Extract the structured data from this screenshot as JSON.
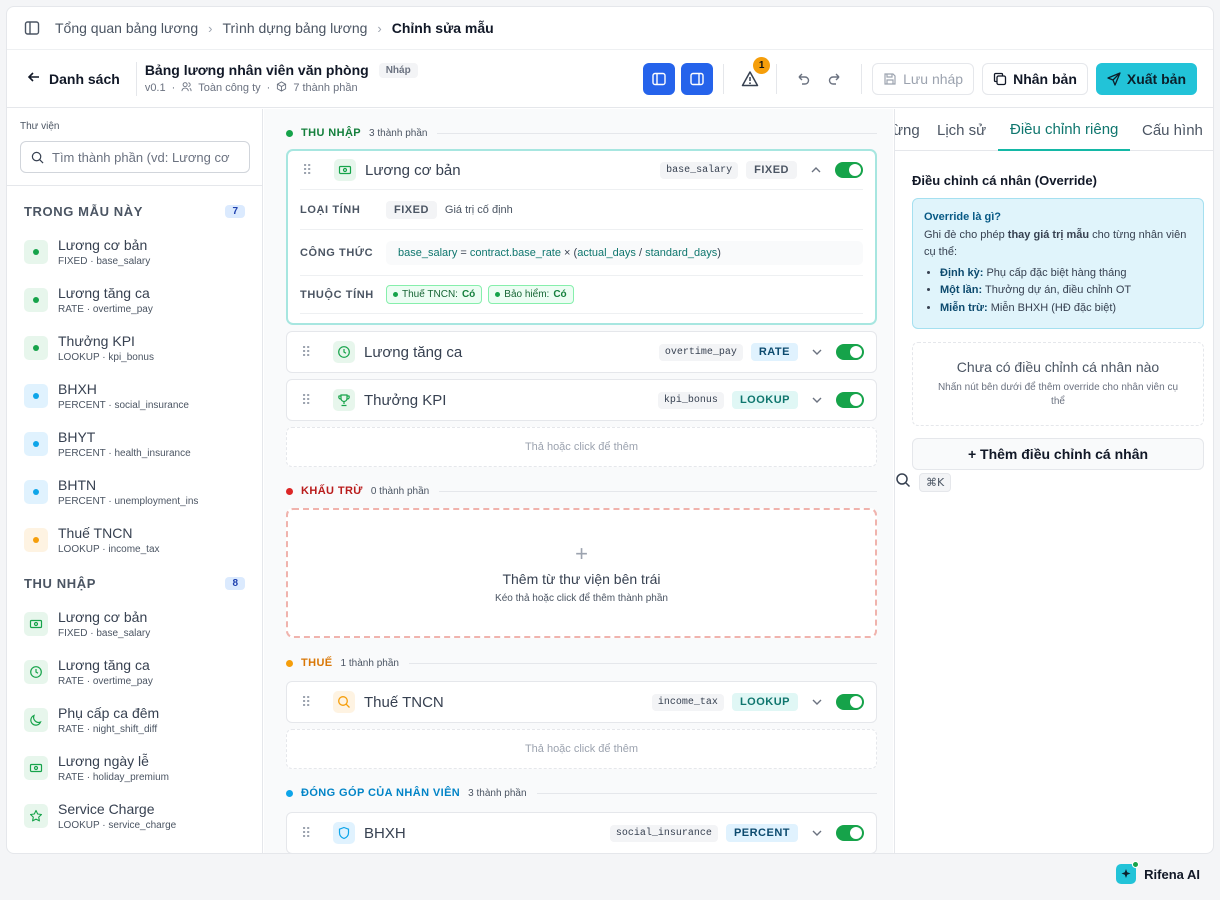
{
  "breadcrumb": {
    "items": [
      "Tổng quan bảng lương",
      "Trình dựng bảng lương",
      "Chỉnh sửa mẫu"
    ],
    "shortcut": "⌘K"
  },
  "header": {
    "back_label": "Danh sách",
    "title": "Bảng lương nhân viên văn phòng",
    "status": "Nháp",
    "version": "v0.1",
    "scope": "Toàn công ty",
    "components": "7 thành phần",
    "warning_count": "1",
    "save_draft": "Lưu nháp",
    "duplicate": "Nhân bản",
    "publish": "Xuất bản"
  },
  "sidebar": {
    "library_label": "Thư viện",
    "search_placeholder": "Tìm thành phần (vd: Lương cơ",
    "in_template": {
      "label": "TRONG MẪU NÀY",
      "count": "7",
      "items": [
        {
          "name": "Lương cơ bản",
          "sub": "FIXED · base_salary",
          "color": "green"
        },
        {
          "name": "Lương tăng ca",
          "sub": "RATE · overtime_pay",
          "color": "green"
        },
        {
          "name": "Thưởng KPI",
          "sub": "LOOKUP · kpi_bonus",
          "color": "green"
        },
        {
          "name": "BHXH",
          "sub": "PERCENT · social_insurance",
          "color": "blue"
        },
        {
          "name": "BHYT",
          "sub": "PERCENT · health_insurance",
          "color": "blue"
        },
        {
          "name": "BHTN",
          "sub": "PERCENT · unemployment_ins",
          "color": "blue"
        },
        {
          "name": "Thuế TNCN",
          "sub": "LOOKUP · income_tax",
          "color": "orange"
        }
      ]
    },
    "income": {
      "label": "THU NHẬP",
      "count": "8",
      "items": [
        {
          "name": "Lương cơ bản",
          "sub": "FIXED · base_salary",
          "icon": "money-icon"
        },
        {
          "name": "Lương tăng ca",
          "sub": "RATE · overtime_pay",
          "icon": "clock-icon"
        },
        {
          "name": "Phụ cấp ca đêm",
          "sub": "RATE · night_shift_diff",
          "icon": "moon-icon"
        },
        {
          "name": "Lương ngày lễ",
          "sub": "RATE · holiday_premium",
          "icon": "money-icon"
        },
        {
          "name": "Service Charge",
          "sub": "LOOKUP · service_charge",
          "icon": "star-icon"
        }
      ]
    }
  },
  "center": {
    "income_group": {
      "label": "THU NHẬP",
      "count": "3 thành phần"
    },
    "base_salary": {
      "name": "Lương cơ bản",
      "key": "base_salary",
      "type": "FIXED",
      "calc_label": "LOẠI TÍNH",
      "calc_value": "FIXED",
      "calc_desc": "Giá trị cố định",
      "formula_label": "CÔNG THỨC",
      "formula": {
        "a": "base_salary",
        "eq": " = ",
        "b": "contract.base_rate",
        "op": " × (",
        "c": "actual_days",
        "div": " / ",
        "d": "standard_days",
        "end": ")"
      },
      "attr_label": "THUỘC TÍNH",
      "attrs": [
        {
          "k": "Thuế TNCN:",
          "v": "Có"
        },
        {
          "k": "Bảo hiểm:",
          "v": "Có"
        }
      ]
    },
    "overtime": {
      "name": "Lương tăng ca",
      "key": "overtime_pay",
      "type": "RATE"
    },
    "kpi": {
      "name": "Thưởng KPI",
      "key": "kpi_bonus",
      "type": "LOOKUP"
    },
    "drop_hint": "Thả hoặc click để thêm",
    "deduction_group": {
      "label": "KHẤU TRỪ",
      "count": "0 thành phần"
    },
    "deduction_empty": {
      "title": "Thêm từ thư viện bên trái",
      "sub": "Kéo thả hoặc click để thêm thành phần"
    },
    "tax_group": {
      "label": "THUẾ",
      "count": "1 thành phần"
    },
    "tax": {
      "name": "Thuế TNCN",
      "key": "income_tax",
      "type": "LOOKUP"
    },
    "contrib_group": {
      "label": "ĐÓNG GÓP CỦA NHÂN VIÊN",
      "count": "3 thành phần"
    },
    "bhxh": {
      "name": "BHXH",
      "key": "social_insurance",
      "type": "PERCENT"
    }
  },
  "right": {
    "tabs": [
      "ừng",
      "Lịch sử",
      "Điều chỉnh riêng",
      "Cấu hình"
    ],
    "active_tab": "Điều chỉnh riêng",
    "title": "Điều chỉnh cá nhân (Override)",
    "info": {
      "heading": "Override là gì?",
      "text_a": "Ghi đè cho phép ",
      "text_b": "thay giá trị mẫu",
      "text_c": " cho từng nhân viên cụ thể:",
      "items": [
        {
          "k": "Định kỳ:",
          "v": " Phụ cấp đặc biệt hàng tháng"
        },
        {
          "k": "Một lần:",
          "v": " Thưởng dự án, điều chỉnh OT"
        },
        {
          "k": "Miễn trừ:",
          "v": " Miễn BHXH (HĐ đặc biệt)"
        }
      ]
    },
    "empty_title": "Chưa có điều chỉnh cá nhân nào",
    "empty_sub": "Nhấn nút bên dưới để thêm override cho nhân viên cụ thể",
    "add_label": "+ Thêm điều chỉnh cá nhân"
  },
  "assistant": {
    "label": "Rifena AI"
  },
  "colors": {
    "accent": "#22c3d8",
    "primary_blue": "#2563eb",
    "income": "#16a34a",
    "deduction": "#dc2626",
    "tax": "#f59e0b",
    "contribution": "#0ea5e9"
  }
}
